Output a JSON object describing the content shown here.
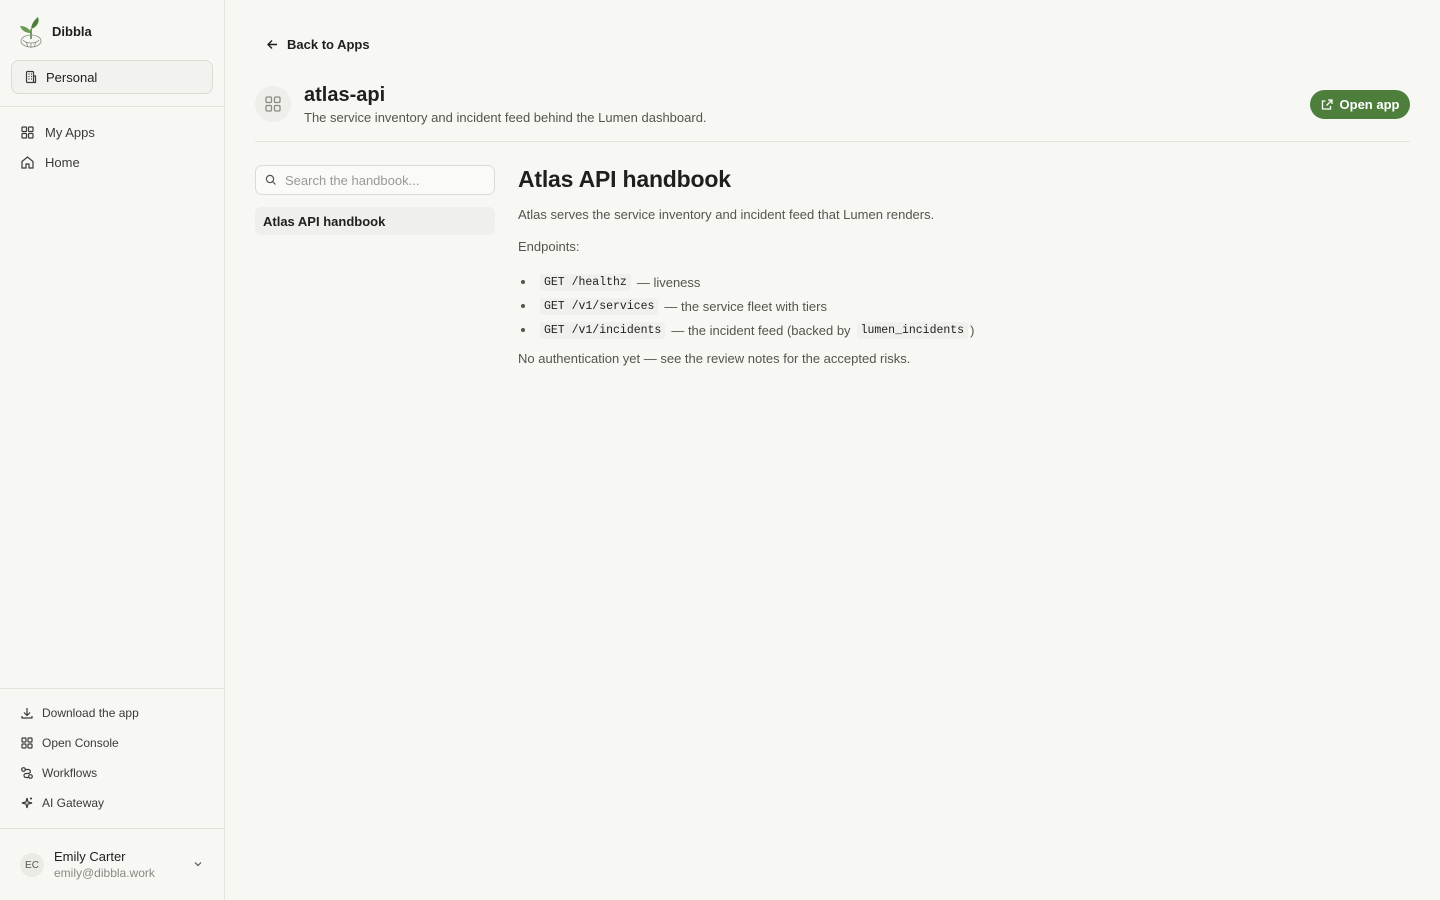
{
  "sidebar": {
    "brand": "Dibbla",
    "workspace": "Personal",
    "nav": [
      {
        "label": "My Apps",
        "icon": "grid-icon"
      },
      {
        "label": "Home",
        "icon": "home-icon"
      }
    ],
    "footer": [
      {
        "label": "Download the app",
        "icon": "download-icon"
      },
      {
        "label": "Open Console",
        "icon": "console-icon"
      },
      {
        "label": "Workflows",
        "icon": "workflow-icon"
      },
      {
        "label": "AI Gateway",
        "icon": "sparkle-icon"
      }
    ],
    "user": {
      "initials": "EC",
      "name": "Emily Carter",
      "email": "emily@dibbla.work"
    }
  },
  "main": {
    "back_label": "Back to Apps",
    "app": {
      "name": "atlas-api",
      "description": "The service inventory and incident feed behind the Lumen dashboard.",
      "open_label": "Open app"
    },
    "search_placeholder": "Search the handbook...",
    "doc_nav": [
      "Atlas API handbook"
    ],
    "doc": {
      "title": "Atlas API handbook",
      "intro": "Atlas serves the service inventory and incident feed that Lumen renders.",
      "endpoints_label": "Endpoints:",
      "endpoints": [
        {
          "code": "GET /healthz",
          "text": "— liveness"
        },
        {
          "code": "GET /v1/services",
          "text": "— the service fleet with tiers"
        },
        {
          "code": "GET /v1/incidents",
          "text": "— the incident feed (backed by",
          "code2": "lumen_incidents",
          "text2": ")"
        }
      ],
      "footer": "No authentication yet — see the review notes for the accepted risks."
    }
  },
  "colors": {
    "accent": "#4d7e3b",
    "background": "#f7f7f4",
    "border": "#e4e4df"
  }
}
